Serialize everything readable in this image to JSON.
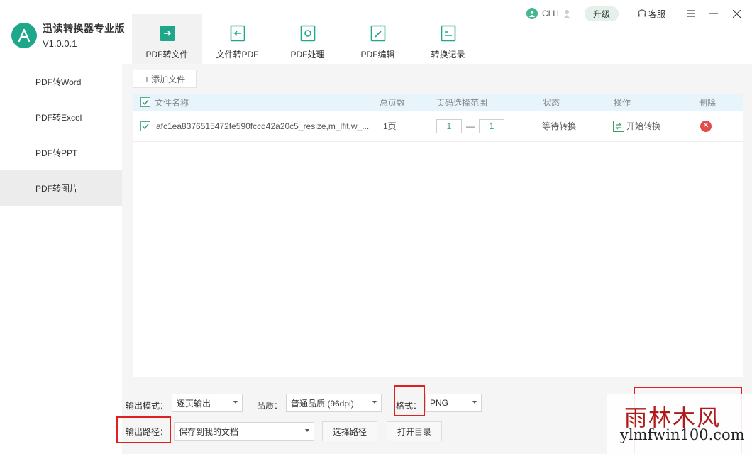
{
  "app": {
    "title": "迅读转换器专业版",
    "version": "V1.0.0.1"
  },
  "topbar": {
    "user_name": "CLH",
    "upgrade": "升级",
    "service": "客服"
  },
  "tabs": [
    {
      "label": "PDF转文件",
      "icon": "pdf-to-file-icon"
    },
    {
      "label": "文件转PDF",
      "icon": "file-to-pdf-icon"
    },
    {
      "label": "PDF处理",
      "icon": "pdf-process-icon"
    },
    {
      "label": "PDF编辑",
      "icon": "pdf-edit-icon"
    },
    {
      "label": "转换记录",
      "icon": "history-icon"
    }
  ],
  "sidebar": {
    "items": [
      {
        "label": "PDF转Word"
      },
      {
        "label": "PDF转Excel"
      },
      {
        "label": "PDF转PPT"
      },
      {
        "label": "PDF转图片"
      }
    ]
  },
  "toolbar": {
    "add_file": "添加文件"
  },
  "table": {
    "headers": {
      "name": "文件名称",
      "pages": "总页数",
      "range": "页码选择范围",
      "status": "状态",
      "action": "操作",
      "delete": "删除"
    },
    "rows": [
      {
        "name": "afc1ea8376515472fe590fccd42a20c5_resize,m_lfit,w_...",
        "pages": "1页",
        "from": "1",
        "to": "1",
        "status": "等待转换",
        "action": "开始转换"
      }
    ]
  },
  "options": {
    "mode_label": "输出模式：",
    "mode_value": "逐页输出",
    "quality_label": "品质：",
    "quality_value": "普通品质 (96dpi)",
    "format_label": "格式：",
    "format_value": "PNG",
    "path_label": "输出路径：",
    "path_value": "保存到我的文档",
    "choose_path": "选择路径",
    "open_dir": "打开目录"
  },
  "watermark": {
    "cn": "雨林木风",
    "en": "ylmfwin100.com"
  },
  "colors": {
    "accent": "#1fa78b",
    "highlight_box": "#e02020",
    "header_row": "#e8f4fb",
    "delete": "#e24b4b"
  }
}
